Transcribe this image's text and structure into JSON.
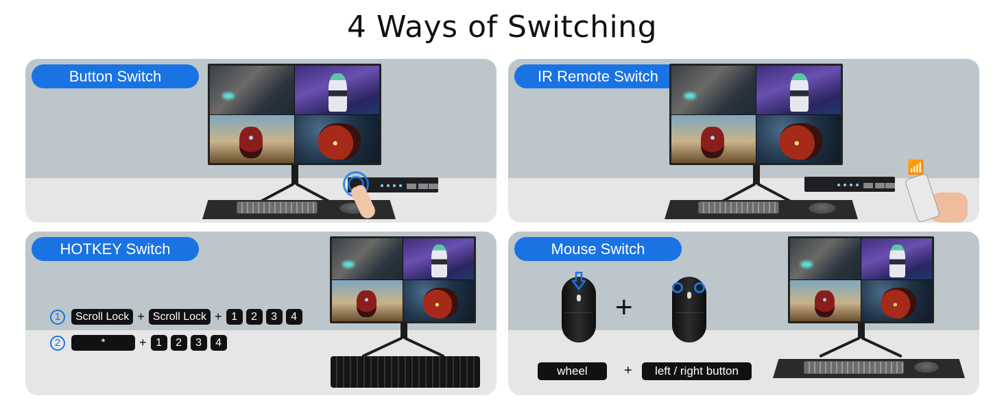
{
  "title": "4 Ways of Switching",
  "accent_color": "#1a73e3",
  "panels": [
    {
      "id": "button",
      "label": "Button Switch"
    },
    {
      "id": "ir",
      "label": "IR Remote Switch"
    },
    {
      "id": "hotkey",
      "label": "HOTKEY Switch",
      "methods": [
        {
          "number": "1",
          "keys": [
            "Scroll Lock",
            "Scroll Lock"
          ],
          "digits": [
            "1",
            "2",
            "3",
            "4"
          ]
        },
        {
          "number": "2",
          "keys": [
            "*"
          ],
          "digits": [
            "1",
            "2",
            "3",
            "4"
          ]
        }
      ],
      "plus": "+"
    },
    {
      "id": "mouse",
      "label": "Mouse Switch",
      "plus": "+",
      "labels": [
        "wheel",
        "left / right button"
      ]
    }
  ]
}
